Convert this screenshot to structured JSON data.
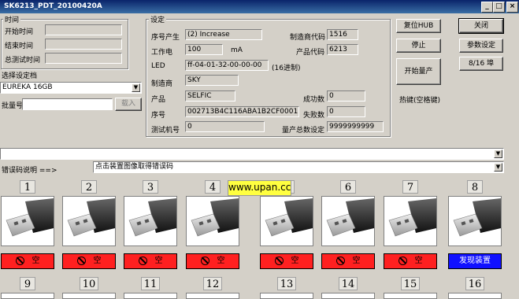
{
  "window": {
    "title": "SK6213_PDT_20100420A"
  },
  "time_group": {
    "title": "时间",
    "start_label": "开始时间",
    "end_label": "结束时间",
    "total_label": "总测试时间"
  },
  "profile": {
    "label": "选择设定档",
    "selected": "EUREKA  16GB",
    "batch_label": "批量号",
    "load_button": "载入"
  },
  "settings_group": {
    "title": "设定",
    "serial_gen_label": "序号产生",
    "serial_gen_value": "(2) Increase",
    "vendor_code_label": "制造商代码",
    "vendor_code_value": "1516",
    "current_label": "工作电",
    "current_value": "100",
    "current_unit": "mA",
    "product_code_label": "产品代码",
    "product_code_value": "6213",
    "led_label": "LED",
    "led_value": "ff-04-01-32-00-00-00",
    "led_note": "(16进制)",
    "vendor_label": "制造商",
    "vendor_value": "SKY",
    "product_label": "产品",
    "product_value": "SELFIC",
    "success_label": "成功数",
    "success_value": "0",
    "serial_label": "序号",
    "serial_value": "002713B4C116ABA1B2CF0001",
    "fail_label": "失败数",
    "fail_value": "0",
    "tester_label": "测试机号",
    "tester_value": "0",
    "total_set_label": "量产总数设定",
    "total_set_value": "9999999999"
  },
  "buttons": {
    "reset_hub": "复位HUB",
    "stop": "停止",
    "start": "开始量产",
    "hotkey_note": "热键(空格键)",
    "close": "关闭",
    "params": "参数设定",
    "ports": "8/16 埠"
  },
  "error_row": {
    "label": "错误码说明 ==>",
    "value": "点击装置图像取得错误码"
  },
  "watermark": "www.upan.cc",
  "slots": [
    {
      "num": "1",
      "status": "空",
      "kind": "empty"
    },
    {
      "num": "2",
      "status": "空",
      "kind": "empty"
    },
    {
      "num": "3",
      "status": "空",
      "kind": "empty"
    },
    {
      "num": "4",
      "status": "空",
      "kind": "empty"
    },
    {
      "num": "5",
      "status": "空",
      "kind": "empty"
    },
    {
      "num": "6",
      "status": "空",
      "kind": "empty"
    },
    {
      "num": "7",
      "status": "空",
      "kind": "empty"
    },
    {
      "num": "8",
      "status": "发现装置",
      "kind": "found"
    }
  ],
  "slots_row2": [
    "9",
    "10",
    "11",
    "12",
    "13",
    "14",
    "15",
    "16"
  ],
  "colors": {
    "title_start": "#0a246a",
    "title_end": "#3a6ea5",
    "empty": "#ff2020",
    "found": "#1010ff",
    "badge": "#ffff40"
  }
}
